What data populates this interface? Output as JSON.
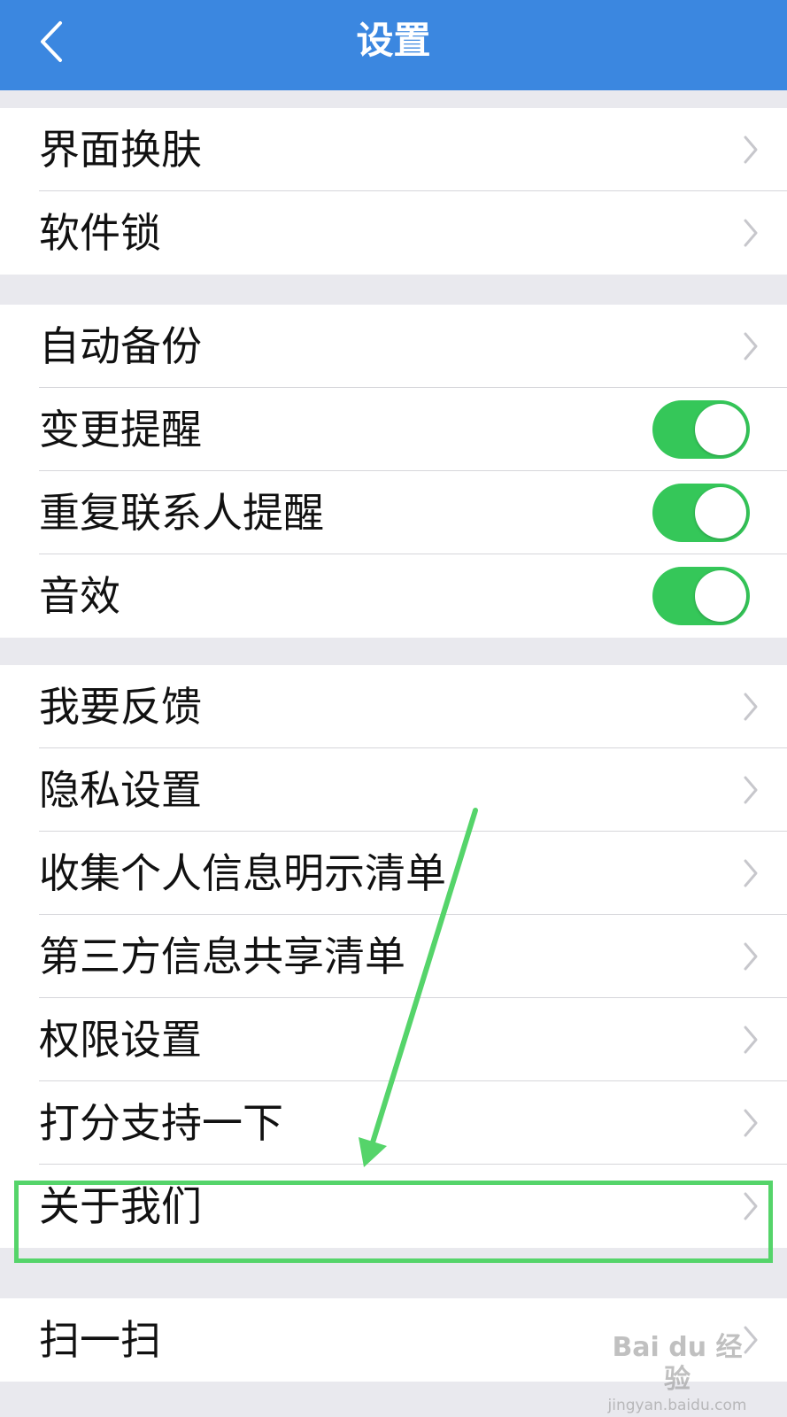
{
  "header": {
    "title": "设置",
    "back_icon": "chevron-left-icon"
  },
  "groups": [
    {
      "items": [
        {
          "label": "界面换肤",
          "control": "chevron"
        },
        {
          "label": "软件锁",
          "control": "chevron"
        }
      ]
    },
    {
      "items": [
        {
          "label": "自动备份",
          "control": "chevron"
        },
        {
          "label": "变更提醒",
          "control": "toggle",
          "on": true
        },
        {
          "label": "重复联系人提醒",
          "control": "toggle",
          "on": true
        },
        {
          "label": "音效",
          "control": "toggle",
          "on": true
        }
      ]
    },
    {
      "items": [
        {
          "label": "我要反馈",
          "control": "chevron"
        },
        {
          "label": "隐私设置",
          "control": "chevron"
        },
        {
          "label": "收集个人信息明示清单",
          "control": "chevron"
        },
        {
          "label": "第三方信息共享清单",
          "control": "chevron"
        },
        {
          "label": "权限设置",
          "control": "chevron"
        },
        {
          "label": "打分支持一下",
          "control": "chevron"
        },
        {
          "label": "关于我们",
          "control": "chevron"
        }
      ]
    },
    {
      "items": [
        {
          "label": "扫一扫",
          "control": "chevron"
        }
      ]
    }
  ],
  "colors": {
    "nav_bar": "#3b87e0",
    "toggle_on": "#35c759",
    "annotation": "#55d46a",
    "background": "#e9e9ee"
  },
  "watermark": {
    "main": "Bai du 经验",
    "sub": "jingyan.baidu.com"
  }
}
